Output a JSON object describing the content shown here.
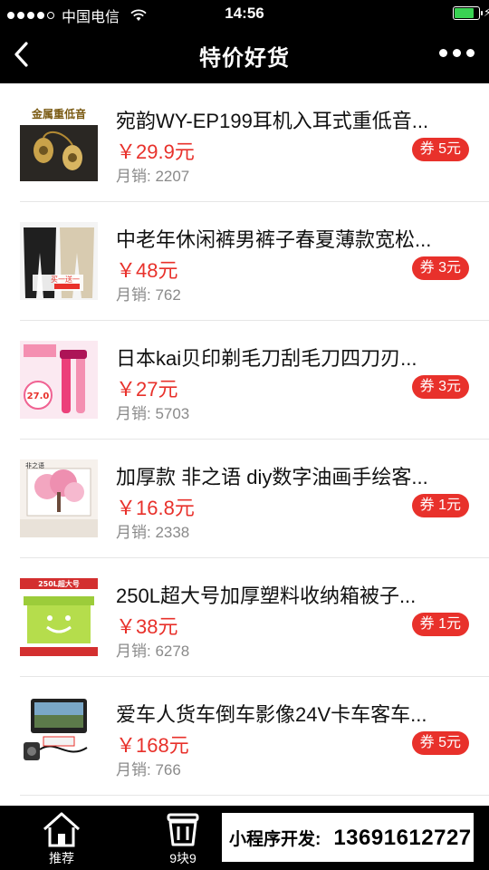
{
  "status_bar": {
    "carrier": "中国电信",
    "time": "14:56",
    "battery_level": 0.82
  },
  "nav": {
    "title": "特价好货"
  },
  "products": [
    {
      "title": "宛韵WY-EP199耳机入耳式重低音...",
      "price": "￥29.9元",
      "sales": "月销: 2207",
      "coupon": "券 5元",
      "thumb_text": "金属重低音"
    },
    {
      "title": "中老年休闲裤男裤子春夏薄款宽松...",
      "price": "￥48元",
      "sales": "月销: 762",
      "coupon": "券 3元",
      "thumb_text": "买一送一"
    },
    {
      "title": "日本kai贝印剃毛刀刮毛刀四刀刃...",
      "price": "￥27元",
      "sales": "月销: 5703",
      "coupon": "券 3元",
      "thumb_text": "27.0"
    },
    {
      "title": "加厚款 非之语 diy数字油画手绘客...",
      "price": "￥16.8元",
      "sales": "月销: 2338",
      "coupon": "券 1元",
      "thumb_text": "非之语"
    },
    {
      "title": "250L超大号加厚塑料收纳箱被子...",
      "price": "￥38元",
      "sales": "月销: 6278",
      "coupon": "券 1元",
      "thumb_text": "250L超大号"
    },
    {
      "title": "爱车人货车倒车影像24V卡车客车...",
      "price": "￥168元",
      "sales": "月销: 766",
      "coupon": "券 5元",
      "thumb_text": ""
    }
  ],
  "tab_bar": {
    "home_label": "推荐",
    "nine_label": "9块9",
    "promo_label": "小程序开发:",
    "promo_phone": "13691612727"
  },
  "colors": {
    "accent": "#e8312b",
    "bar_bg": "#000000"
  }
}
